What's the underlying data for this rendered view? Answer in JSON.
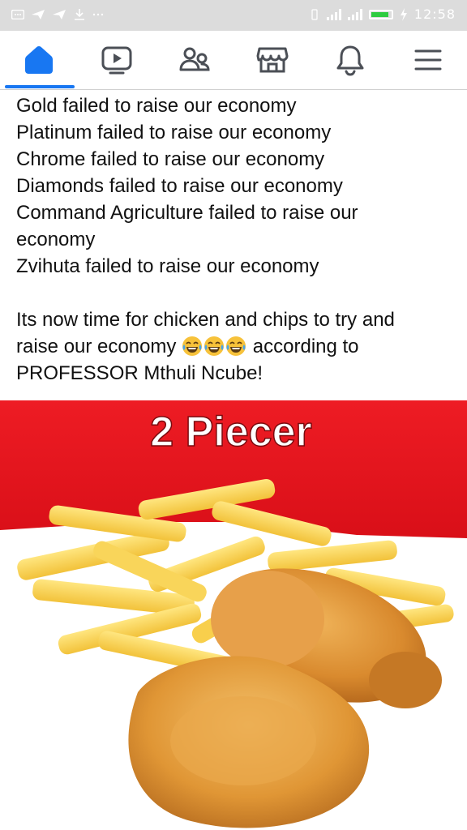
{
  "status_bar": {
    "notification_icons": [
      "message-icon",
      "send-icon",
      "send-icon",
      "download-icon",
      "more-icon"
    ],
    "system_icons": [
      "vibrate-icon",
      "signal-icon",
      "signal-icon",
      "battery-icon",
      "charging-icon"
    ],
    "time": "12:58",
    "battery_level": 0.8
  },
  "nav": {
    "tabs": [
      {
        "name": "home",
        "icon": "home-icon",
        "active": true
      },
      {
        "name": "watch",
        "icon": "video-play-icon",
        "active": false
      },
      {
        "name": "friends",
        "icon": "friends-icon",
        "active": false
      },
      {
        "name": "marketplace",
        "icon": "marketplace-icon",
        "active": false
      },
      {
        "name": "notifications",
        "icon": "bell-icon",
        "active": false
      },
      {
        "name": "menu",
        "icon": "hamburger-menu-icon",
        "active": false
      }
    ],
    "accent": "#1877f2"
  },
  "post": {
    "lines": [
      "Gold failed to raise our economy",
      "Platinum failed to raise our economy",
      "Chrome failed to raise our economy",
      "Diamonds failed to raise our economy",
      "Command Agriculture failed to raise our",
      "economy",
      "Zvihuta failed to raise our economy"
    ],
    "para2_line1": "Its now time for chicken and chips to try and",
    "para2_line2_before": "raise our economy",
    "para2_line2_after": "according to",
    "para2_line3": "PROFESSOR Mthuli Ncube!",
    "emojis": [
      "tears-of-joy-emoji",
      "tears-of-joy-emoji",
      "tears-of-joy-emoji"
    ]
  },
  "image": {
    "banner_text": "2 Piecer",
    "banner_color": "#e3141b",
    "content": [
      "french-fries",
      "fried-chicken-drumstick",
      "fried-chicken-piece"
    ]
  }
}
